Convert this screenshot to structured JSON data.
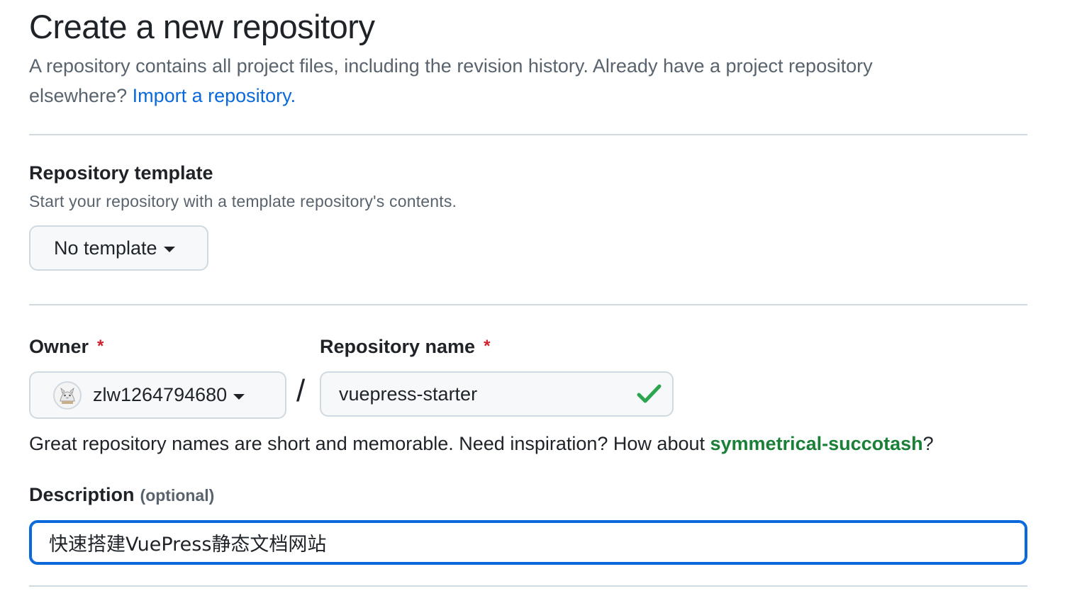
{
  "header": {
    "title": "Create a new repository",
    "intro_text": "A repository contains all project files, including the revision history. Already have a project repository elsewhere? ",
    "import_link": "Import a repository."
  },
  "template_section": {
    "heading": "Repository template",
    "subtext": "Start your repository with a template repository's contents.",
    "dropdown_label": "No template"
  },
  "owner": {
    "label": "Owner",
    "required_mark": "*",
    "value": "zlw1264794680"
  },
  "separator": "/",
  "repo_name": {
    "label": "Repository name",
    "required_mark": "*",
    "value": "vuepress-starter",
    "valid_icon": "check-icon"
  },
  "name_hint": {
    "text": "Great repository names are short and memorable. Need inspiration? How about ",
    "suggestion": "symmetrical-succotash",
    "suffix": "?"
  },
  "description": {
    "label": "Description",
    "optional_label": "(optional)",
    "value": "快速搭建VuePress静态文档网站"
  },
  "colors": {
    "link": "#0969da",
    "success": "#1a7f37",
    "required": "#cf222e",
    "focus_border": "#0969da"
  }
}
